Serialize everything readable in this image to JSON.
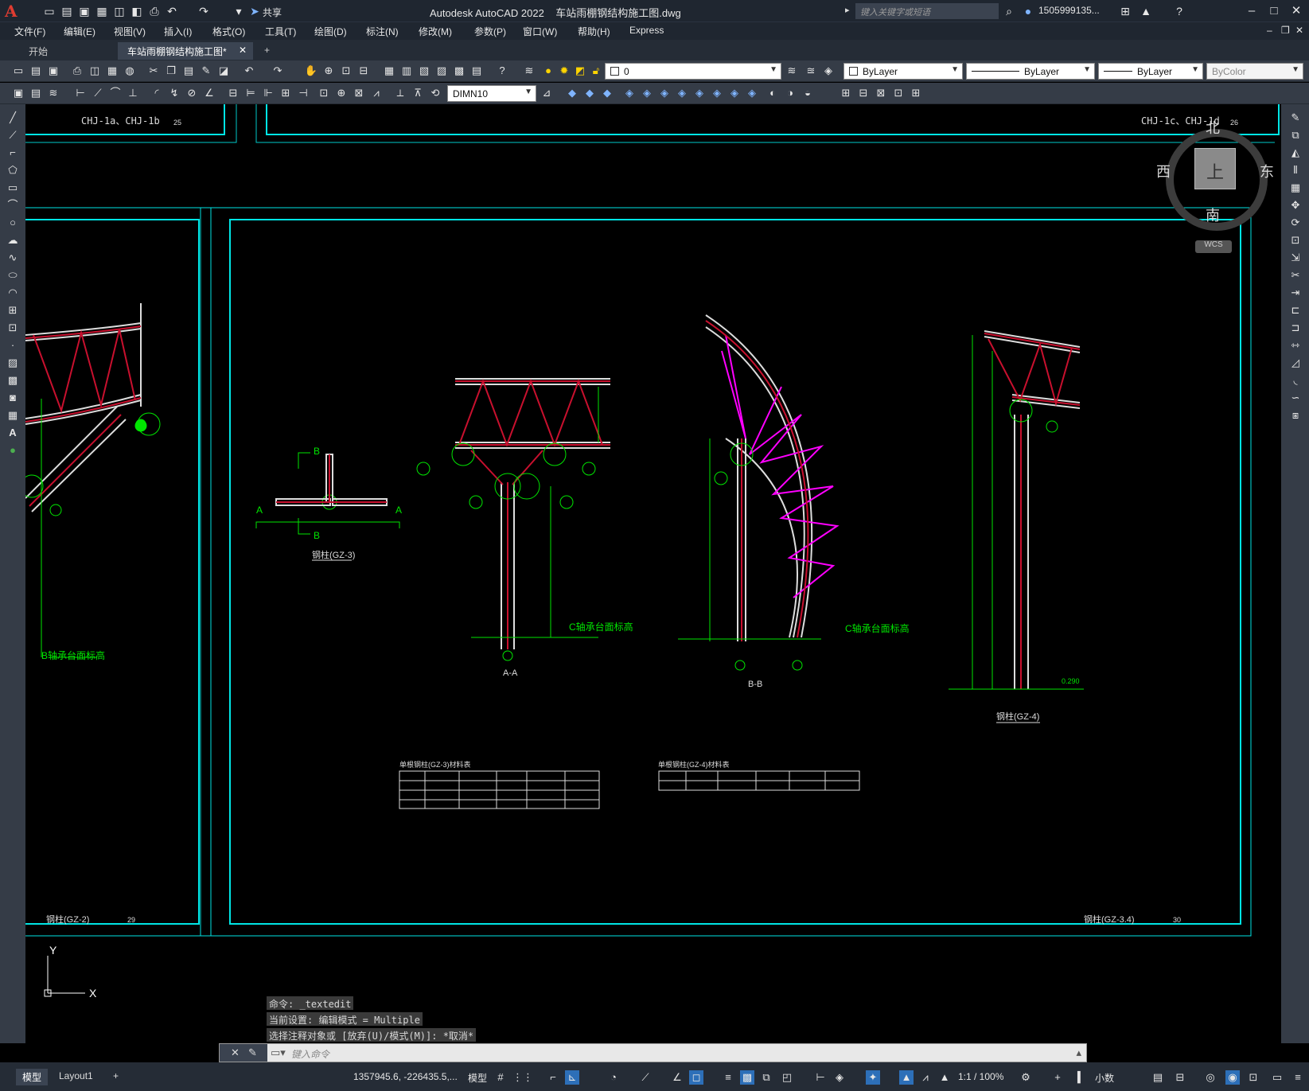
{
  "titlebar": {
    "app_name": "Autodesk AutoCAD 2022",
    "file_name": "车站雨棚钢结构施工图.dwg",
    "share_label": "共享",
    "search_placeholder": "键入关键字或短语",
    "user_name": "1505999135..."
  },
  "menus": [
    "文件(F)",
    "编辑(E)",
    "视图(V)",
    "插入(I)",
    "格式(O)",
    "工具(T)",
    "绘图(D)",
    "标注(N)",
    "修改(M)",
    "参数(P)",
    "窗口(W)",
    "帮助(H)",
    "Express"
  ],
  "tabs": [
    {
      "label": "开始",
      "active": false
    },
    {
      "label": "车站雨棚钢结构施工图*",
      "active": true
    }
  ],
  "toolbar_props": {
    "layer": "0",
    "color": "ByLayer",
    "linetype": "ByLayer",
    "lineweight": "ByLayer",
    "plotstyle": "ByColor",
    "dimstyle": "DIMN10"
  },
  "viewcube": {
    "north": "北",
    "south": "南",
    "east": "东",
    "west": "西",
    "top": "上",
    "wcs": "WCS"
  },
  "drawing": {
    "sheet_left_title": "CHJ-1a、CHJ-1b",
    "sheet_left_num": "25",
    "sheet_right_title": "CHJ-1c、CHJ-1d",
    "sheet_right_num": "26",
    "sheet29_title": "钢柱(GZ-2)",
    "sheet29_num": "29",
    "sheet30_title": "钢柱(GZ-3.4)",
    "sheet30_num": "30",
    "gz2_elev": "B轴承台面标高",
    "gz3_title": "钢柱(GZ-3)",
    "gz3_elev": "C轴承台面标高",
    "section_aa": "A-A",
    "section_bb": "B-B",
    "bb_elev": "C轴承台面标高",
    "gz4_title": "钢柱(GZ-4)",
    "gz4_elev": "0.290",
    "axis_c": "C",
    "label_a": "A",
    "label_b": "B",
    "table1_title": "单根钢柱(GZ-3)材料表",
    "table2_title": "单根钢柱(GZ-4)材料表"
  },
  "command": {
    "history": [
      "命令: _textedit",
      "当前设置: 编辑模式 = Multiple",
      "选择注释对象或 [放弃(U)/模式(M)]: *取消*"
    ],
    "placeholder": "键入命令"
  },
  "statusbar": {
    "model_tab": "模型",
    "layout_tab": "Layout1",
    "coords": "1357945.6, -226435.5,...",
    "space": "模型",
    "scale": "1:1 / 100%",
    "units": "小数"
  }
}
